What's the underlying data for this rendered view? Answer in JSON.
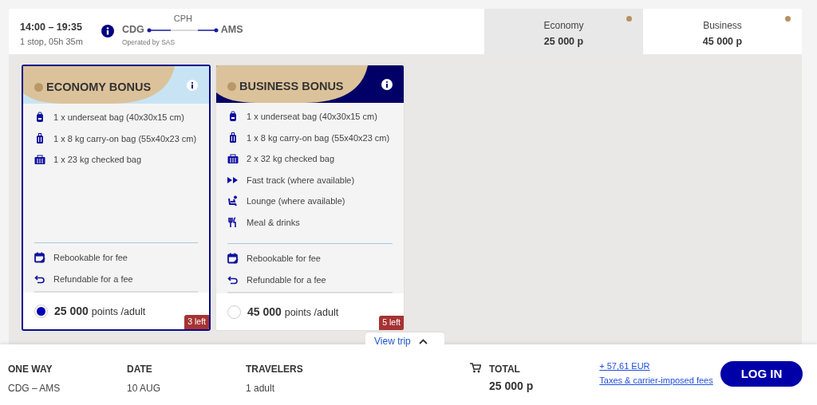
{
  "flight": {
    "times": "14:00 – 19:35",
    "duration": "1 stop, 05h 35m",
    "from": "CDG",
    "via": "CPH",
    "to": "AMS",
    "operator": "Operated by SAS"
  },
  "fare_tabs": [
    {
      "label": "Economy",
      "price": "25 000 p",
      "selected": true
    },
    {
      "label": "Business",
      "price": "45 000 p",
      "selected": false
    }
  ],
  "cards": [
    {
      "kind": "economy",
      "title": "ECONOMY BONUS",
      "selected": true,
      "points": "25 000",
      "unit": "points /adult",
      "left": "3 left",
      "features": [
        {
          "kind": "underseat",
          "text": "1 x underseat bag (40x30x15 cm)"
        },
        {
          "kind": "carryon",
          "text": "1 x 8 kg carry-on bag (55x40x23 cm)"
        },
        {
          "kind": "checked",
          "text": "1 x 23 kg checked bag"
        }
      ],
      "conditions": [
        {
          "kind": "rebook",
          "text": "Rebookable for fee"
        },
        {
          "kind": "refund",
          "text": "Refundable for a fee"
        }
      ]
    },
    {
      "kind": "business",
      "title": "BUSINESS BONUS",
      "selected": false,
      "points": "45 000",
      "unit": "points /adult",
      "left": "5 left",
      "features": [
        {
          "kind": "underseat",
          "text": "1 x underseat bag (40x30x15 cm)"
        },
        {
          "kind": "carryon",
          "text": "1 x 8 kg carry-on bag (55x40x23 cm)"
        },
        {
          "kind": "checked",
          "text": "2 x 32 kg checked bag"
        },
        {
          "kind": "fasttrack",
          "text": "Fast track (where available)"
        },
        {
          "kind": "lounge",
          "text": "Lounge (where available)"
        },
        {
          "kind": "meal",
          "text": "Meal & drinks"
        }
      ],
      "conditions": [
        {
          "kind": "rebook",
          "text": "Rebookable for fee"
        },
        {
          "kind": "refund",
          "text": "Refundable for a fee"
        }
      ]
    }
  ],
  "view_trip": "View trip",
  "summary": [
    {
      "label": "ONE WAY",
      "value": "CDG – AMS"
    },
    {
      "label": "DATE",
      "value": "10 AUG"
    },
    {
      "label": "TRAVELERS",
      "value": "1 adult"
    }
  ],
  "total": {
    "label": "TOTAL",
    "value": "25 000 p"
  },
  "fees": {
    "amount": "+ 57,61 EUR",
    "label": "Taxes & carrier-imposed fees"
  },
  "login": "LOG IN"
}
